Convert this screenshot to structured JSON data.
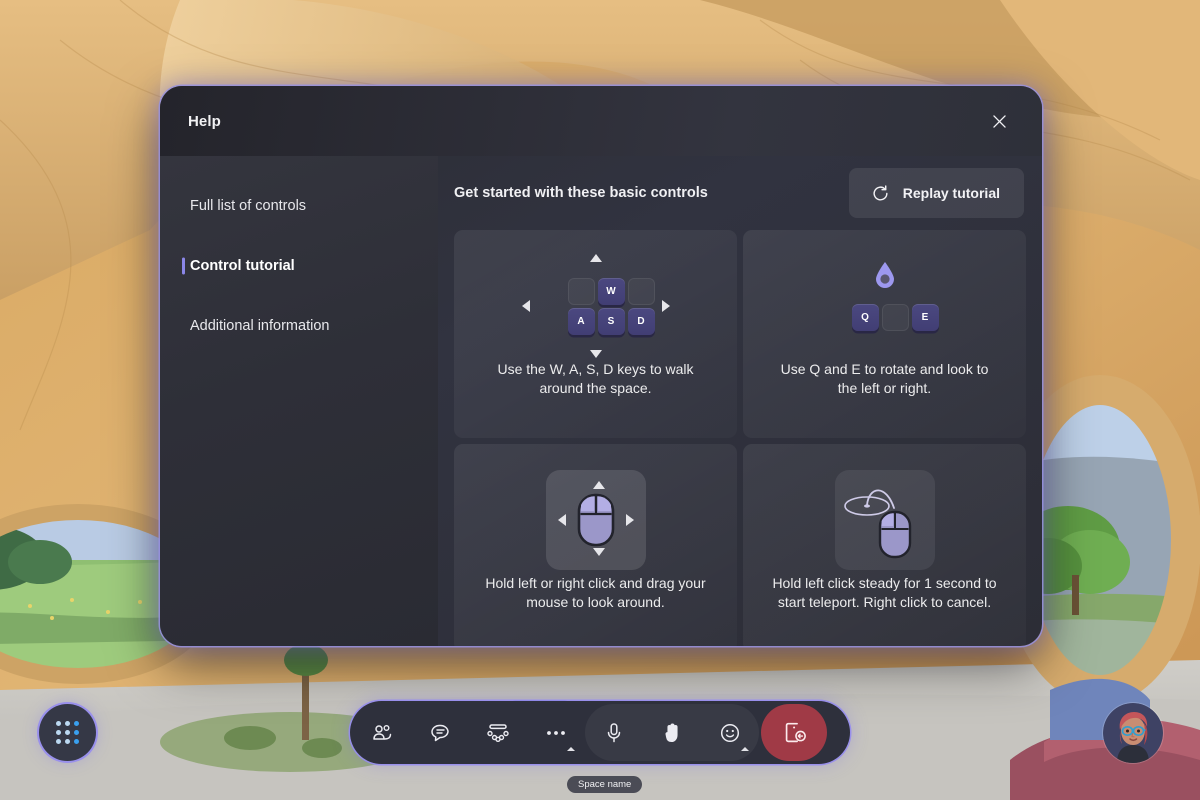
{
  "dialog": {
    "title": "Help",
    "close_label": "Close",
    "sidebar": {
      "items": [
        {
          "label": "Full list of controls",
          "active": false
        },
        {
          "label": "Control tutorial",
          "active": true
        },
        {
          "label": "Additional information",
          "active": false
        }
      ]
    },
    "content": {
      "heading": "Get started with these basic controls",
      "replay_label": "Replay tutorial",
      "cards": [
        {
          "id": "wasd",
          "caption": "Use the W, A, S, D keys to walk around the space.",
          "keys": [
            "W",
            "A",
            "S",
            "D"
          ],
          "icon": "wasd-keys-icon"
        },
        {
          "id": "qe",
          "caption": "Use Q and E to rotate and look to the left or right.",
          "keys": [
            "Q",
            "E"
          ],
          "icon": "rotate-loop-icon"
        },
        {
          "id": "look",
          "caption": "Hold left or right click and drag your mouse to look around.",
          "keys": [],
          "icon": "mouse-drag-icon"
        },
        {
          "id": "teleport",
          "caption": "Hold left click steady for 1 second to start teleport. Right click to cancel.",
          "keys": [],
          "icon": "mouse-teleport-icon"
        }
      ]
    }
  },
  "bottom_bar": {
    "app_launcher_label": "Apps",
    "buttons": [
      {
        "id": "people",
        "label": "People",
        "icon": "people-icon",
        "chevron": false
      },
      {
        "id": "chat",
        "label": "Chat",
        "icon": "chat-icon",
        "chevron": false
      },
      {
        "id": "seating",
        "label": "Seating",
        "icon": "seating-icon",
        "chevron": false
      },
      {
        "id": "more",
        "label": "More",
        "icon": "more-icon",
        "chevron": true
      },
      {
        "id": "mic",
        "label": "Mic",
        "icon": "microphone-icon",
        "chevron": false
      },
      {
        "id": "hand",
        "label": "Raise hand",
        "icon": "raise-hand-icon",
        "chevron": false
      },
      {
        "id": "emoji",
        "label": "Reactions",
        "icon": "emoji-icon",
        "chevron": true
      }
    ],
    "leave": {
      "label": "Leave",
      "icon": "leave-icon"
    },
    "space_name": "Space name",
    "avatar_label": "Your avatar"
  },
  "colors": {
    "accent": "#8b86e8",
    "key_cap": "#4b4880",
    "leave_red": "#a03a46",
    "dialog_bg": "#2f3038",
    "toolbar_bg": "#2e303c"
  }
}
